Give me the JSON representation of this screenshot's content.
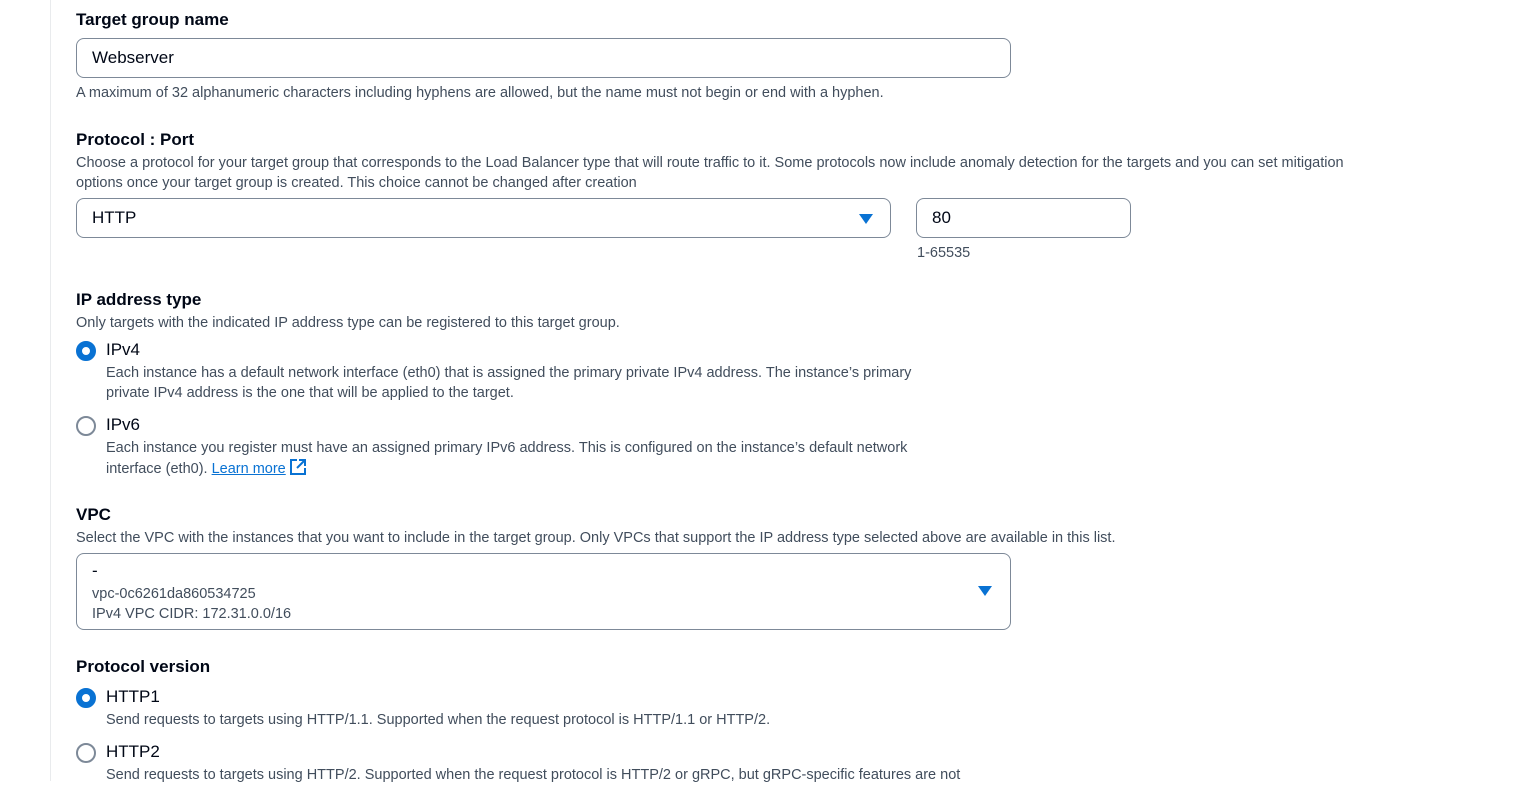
{
  "target_group_name": {
    "label": "Target group name",
    "value": "Webserver",
    "hint": "A maximum of 32 alphanumeric characters including hyphens are allowed, but the name must not begin or end with a hyphen."
  },
  "protocol_port": {
    "label": "Protocol : Port",
    "description_line1": "Choose a protocol for your target group that corresponds to the Load Balancer type that will route traffic to it. Some protocols now include anomaly detection for the targets and you can set mitigation",
    "description_line2": "options once your target group is created. This choice cannot be changed after creation",
    "protocol_value": "HTTP",
    "port_value": "80",
    "port_hint": "1-65535"
  },
  "ip_address_type": {
    "label": "IP address type",
    "description": "Only targets with the indicated IP address type can be registered to this target group.",
    "options": [
      {
        "label": "IPv4",
        "selected": true,
        "desc_line1": "Each instance has a default network interface (eth0) that is assigned the primary private IPv4 address. The instance’s primary",
        "desc_line2": "private IPv4 address is the one that will be applied to the target."
      },
      {
        "label": "IPv6",
        "selected": false,
        "desc_line1": "Each instance you register must have an assigned primary IPv6 address. This is configured on the instance’s default network",
        "desc_line2": "interface (eth0).",
        "link": "Learn more"
      }
    ]
  },
  "vpc": {
    "label": "VPC",
    "description": "Select the VPC with the instances that you want to include in the target group. Only VPCs that support the IP address type selected above are available in this list.",
    "selected_name": "-",
    "selected_id": "vpc-0c6261da860534725",
    "selected_cidr": "IPv4 VPC CIDR: 172.31.0.0/16"
  },
  "protocol_version": {
    "label": "Protocol version",
    "options": [
      {
        "label": "HTTP1",
        "selected": true,
        "desc": "Send requests to targets using HTTP/1.1. Supported when the request protocol is HTTP/1.1 or HTTP/2."
      },
      {
        "label": "HTTP2",
        "selected": false,
        "desc": "Send requests to targets using HTTP/2. Supported when the request protocol is HTTP/2 or gRPC, but gRPC-specific features are not"
      }
    ]
  },
  "colors": {
    "accent": "#0972d3",
    "border": "#7d8998",
    "text": "#000716",
    "secondary_text": "#414d5c"
  }
}
